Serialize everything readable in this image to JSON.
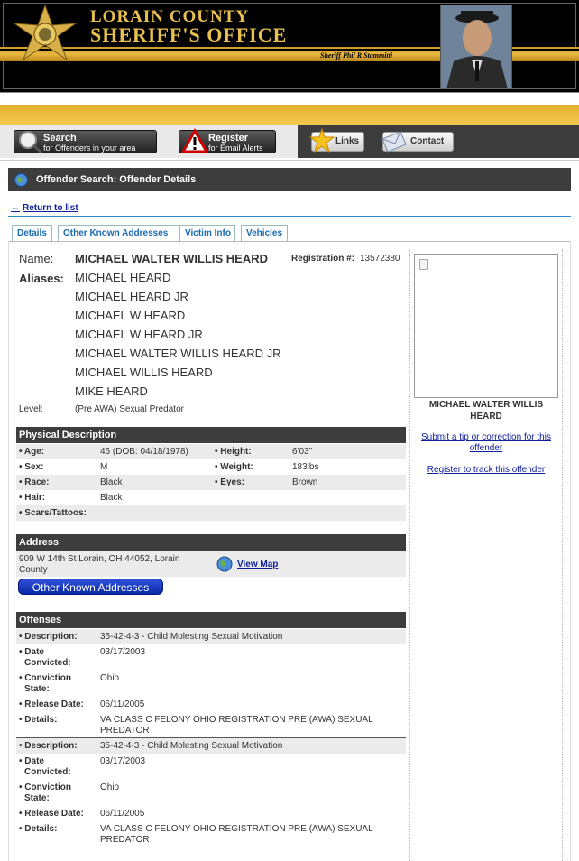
{
  "header": {
    "title_line1": "Lorain County",
    "title_line2": "Sheriff's Office",
    "sheriff_name": "Sheriff Phil R Stammitti"
  },
  "nav": {
    "search_title": "Search",
    "search_sub": "for Offenders in your area",
    "register_title": "Register",
    "register_sub": "for Email Alerts",
    "links": "Links",
    "contact": "Contact"
  },
  "page": {
    "title": "Offender Search: Offender Details",
    "return_link": "Return to list"
  },
  "tabs": [
    "Details",
    "Other Known Addresses",
    "Victim Info",
    "Vehicles"
  ],
  "offender": {
    "name_label": "Name:",
    "name": "MICHAEL WALTER WILLIS HEARD",
    "registration_label": "Registration #:",
    "registration": "13572380",
    "aliases_label": "Aliases:",
    "aliases": [
      "MICHAEL HEARD",
      "MICHAEL HEARD JR",
      "MICHAEL W HEARD",
      "MICHAEL W HEARD JR",
      "MICHAEL WALTER WILLIS HEARD JR",
      "MICHAEL WILLIS HEARD",
      "MIKE HEARD"
    ],
    "level_label": "Level:",
    "level": "(Pre AWA) Sexual Predator"
  },
  "sidebar": {
    "photo_name": "MICHAEL WALTER WILLIS HEARD",
    "tip_link": "Submit a tip or correction for this offender",
    "track_link": "Register to track this offender"
  },
  "physical": {
    "heading": "Physical Description",
    "age_label": "• Age:",
    "age": "46  (DOB: 04/18/1978)",
    "height_label": "• Height:",
    "height": "6'03\"",
    "sex_label": "• Sex:",
    "sex": "M",
    "weight_label": "• Weight:",
    "weight": "183lbs",
    "race_label": "• Race:",
    "race": "Black",
    "eyes_label": "• Eyes:",
    "eyes": "Brown",
    "hair_label": "• Hair:",
    "hair": "Black",
    "scars_label": "• Scars/Tattoos:",
    "scars": ""
  },
  "address": {
    "heading": "Address",
    "line1": "909 W 14th St Lorain, OH 44052, Lorain",
    "line2": "County",
    "view_map": "View Map",
    "other_button": "Other Known Addresses"
  },
  "offenses": {
    "heading": "Offenses",
    "labels": {
      "description": "• Description:",
      "date1": "• Date",
      "date2": "Convicted:",
      "state1": "• Conviction",
      "state2": "State:",
      "release": "• Release Date:",
      "details": "• Details:"
    },
    "items": [
      {
        "description": "35-42-4-3 - Child Molesting    Sexual Motivation",
        "date_convicted": "03/17/2003",
        "state": "Ohio",
        "release_date": "06/11/2005",
        "details_1": "VA CLASS C FELONY OHIO REGISTRATION PRE (AWA) SEXUAL",
        "details_2": "PREDATOR"
      },
      {
        "description": "35-42-4-3 - Child Molesting    Sexual Motivation",
        "date_convicted": "03/17/2003",
        "state": "Ohio",
        "release_date": "06/11/2005",
        "details_1": "VA CLASS C FELONY OHIO REGISTRATION PRE (AWA) SEXUAL",
        "details_2": "PREDATOR"
      }
    ]
  }
}
